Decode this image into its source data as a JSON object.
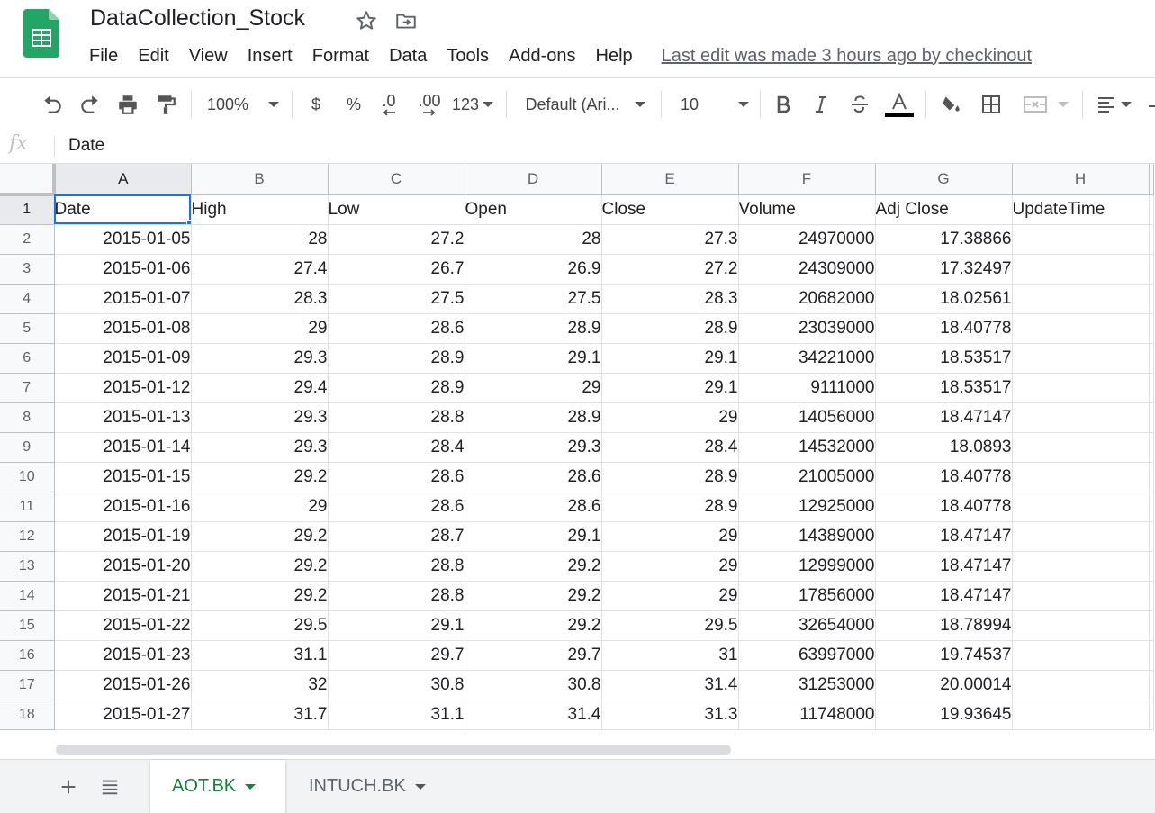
{
  "doc": {
    "title": "DataCollection_Stock",
    "last_edit": "Last edit was made 3 hours ago by checkinout"
  },
  "menu": [
    "File",
    "Edit",
    "View",
    "Insert",
    "Format",
    "Data",
    "Tools",
    "Add-ons",
    "Help"
  ],
  "toolbar": {
    "zoom": "100%",
    "currency": "$",
    "percent": "%",
    "dec_decrease": ".0",
    "dec_increase": ".00",
    "more_formats": "123",
    "font": "Default (Ari...",
    "font_size": "10",
    "text_color": "#000000"
  },
  "formula": {
    "fx": "fx",
    "value": "Date"
  },
  "sheet": {
    "active_cell": "A1",
    "columns": [
      "A",
      "B",
      "C",
      "D",
      "E",
      "F",
      "G",
      "H"
    ],
    "header_row": [
      "Date",
      "High",
      "Low",
      "Open",
      "Close",
      "Volume",
      "Adj Close",
      "UpdateTime"
    ],
    "rows": [
      [
        "2015-01-05",
        "28",
        "27.2",
        "28",
        "27.3",
        "24970000",
        "17.38866",
        ""
      ],
      [
        "2015-01-06",
        "27.4",
        "26.7",
        "26.9",
        "27.2",
        "24309000",
        "17.32497",
        ""
      ],
      [
        "2015-01-07",
        "28.3",
        "27.5",
        "27.5",
        "28.3",
        "20682000",
        "18.02561",
        ""
      ],
      [
        "2015-01-08",
        "29",
        "28.6",
        "28.9",
        "28.9",
        "23039000",
        "18.40778",
        ""
      ],
      [
        "2015-01-09",
        "29.3",
        "28.9",
        "29.1",
        "29.1",
        "34221000",
        "18.53517",
        ""
      ],
      [
        "2015-01-12",
        "29.4",
        "28.9",
        "29",
        "29.1",
        "9111000",
        "18.53517",
        ""
      ],
      [
        "2015-01-13",
        "29.3",
        "28.8",
        "28.9",
        "29",
        "14056000",
        "18.47147",
        ""
      ],
      [
        "2015-01-14",
        "29.3",
        "28.4",
        "29.3",
        "28.4",
        "14532000",
        "18.0893",
        ""
      ],
      [
        "2015-01-15",
        "29.2",
        "28.6",
        "28.6",
        "28.9",
        "21005000",
        "18.40778",
        ""
      ],
      [
        "2015-01-16",
        "29",
        "28.6",
        "28.6",
        "28.9",
        "12925000",
        "18.40778",
        ""
      ],
      [
        "2015-01-19",
        "29.2",
        "28.7",
        "29.1",
        "29",
        "14389000",
        "18.47147",
        ""
      ],
      [
        "2015-01-20",
        "29.2",
        "28.8",
        "29.2",
        "29",
        "12999000",
        "18.47147",
        ""
      ],
      [
        "2015-01-21",
        "29.2",
        "28.8",
        "29.2",
        "29",
        "17856000",
        "18.47147",
        ""
      ],
      [
        "2015-01-22",
        "29.5",
        "29.1",
        "29.2",
        "29.5",
        "32654000",
        "18.78994",
        ""
      ],
      [
        "2015-01-23",
        "31.1",
        "29.7",
        "29.7",
        "31",
        "63997000",
        "19.74537",
        ""
      ],
      [
        "2015-01-26",
        "32",
        "30.8",
        "30.8",
        "31.4",
        "31253000",
        "20.00014",
        ""
      ],
      [
        "2015-01-27",
        "31.7",
        "31.1",
        "31.4",
        "31.3",
        "11748000",
        "19.93645",
        ""
      ]
    ]
  },
  "tabs": [
    {
      "label": "AOT.BK",
      "active": true
    },
    {
      "label": "INTUCH.BK",
      "active": false
    }
  ],
  "colors": {
    "accent": "#188038",
    "selection": "#1a73e8",
    "logo_green": "#23a566"
  }
}
